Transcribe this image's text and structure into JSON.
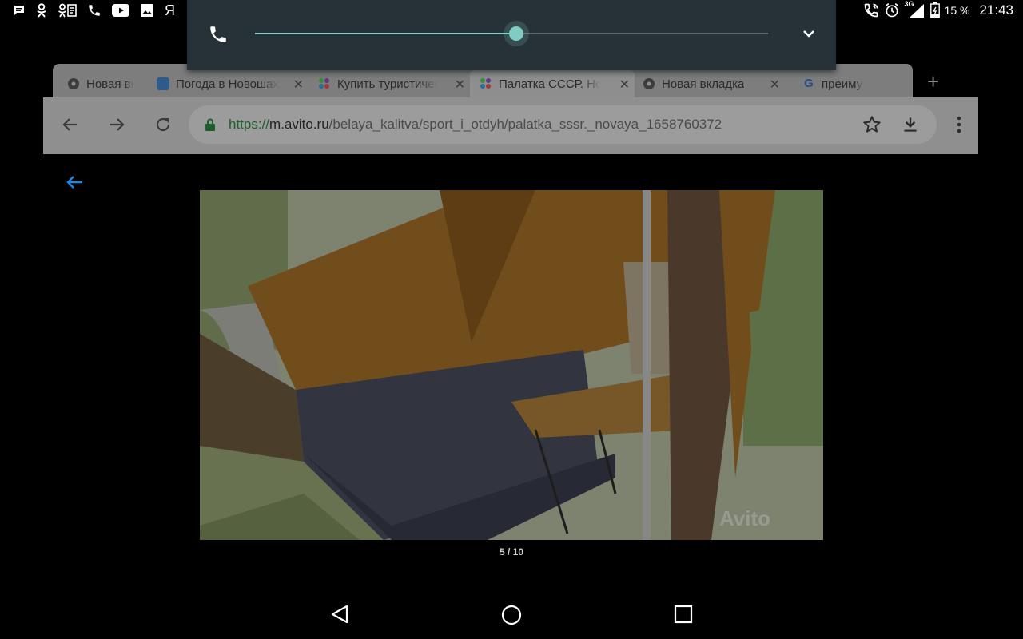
{
  "status_bar": {
    "left_icons": [
      "message-icon",
      "odnoklassniki-icon",
      "odnoklassniki-multi-icon",
      "phone-icon",
      "youtube-icon",
      "gallery-icon",
      "yandex-icon"
    ],
    "yandex_glyph": "Я",
    "right_icons": [
      "wifi-calling-icon",
      "alarm-icon",
      "signal-3g-icon",
      "battery-icon"
    ],
    "network_label": "3G",
    "battery": "15 %",
    "time": "21:43"
  },
  "volume_panel": {
    "stream_icon": "phone-icon",
    "level": 0.51,
    "expand_icon": "chevron-down-icon"
  },
  "browser": {
    "tabs": [
      {
        "title": "Новая вкладка",
        "favicon": "chrome-icon",
        "active": false
      },
      {
        "title": "Погода в Новошахтинске",
        "favicon": "weather-icon",
        "active": false
      },
      {
        "title": "Купить туристическую палатку",
        "favicon": "avito-icon",
        "active": false
      },
      {
        "title": "Палатка СССР. Новая",
        "favicon": "avito-icon",
        "active": true
      },
      {
        "title": "Новая вкладка",
        "favicon": "chrome-icon",
        "active": false
      },
      {
        "title": "преимущества",
        "favicon": "google-icon",
        "active": false
      }
    ],
    "new_tab_label": "+",
    "url": {
      "scheme": "https://",
      "host": "m.avito.ru",
      "path": "/belaya_kalitva/sport_i_otdyh/palatka_sssr._novaya_1658760372"
    }
  },
  "gallery": {
    "watermark": "Avito",
    "counter": "5 / 10"
  },
  "colors": {
    "accent": "#80cbc4",
    "volume_panel_bg": "#263238",
    "gallery_back": "#1e88e5"
  }
}
